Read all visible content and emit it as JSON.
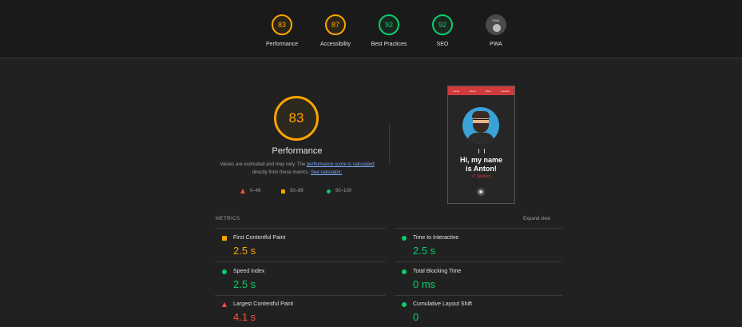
{
  "top_gauges": [
    {
      "score": "83",
      "label": "Performance",
      "color": "#ffa400"
    },
    {
      "score": "87",
      "label": "Accessibility",
      "color": "#ffa400"
    },
    {
      "score": "92",
      "label": "Best Practices",
      "color": "#0cce6b"
    },
    {
      "score": "92",
      "label": "SEO",
      "color": "#0cce6b"
    }
  ],
  "pwa": {
    "badge_text": "PWA",
    "label": "PWA",
    "icon": "pwa-badge-icon"
  },
  "performance": {
    "score": "83",
    "title": "Performance",
    "desc_1": "Values are estimated and may vary. The ",
    "link_1": "performance score is calculated",
    "desc_2": " directly from these metrics. ",
    "link_2": "See calculator."
  },
  "legend": [
    {
      "label": "0–49",
      "icon": "fail-triangle-icon",
      "color": "#ff4e42"
    },
    {
      "label": "50–89",
      "icon": "average-square-icon",
      "color": "#ffa400"
    },
    {
      "label": "90–100",
      "icon": "pass-circle-icon",
      "color": "#0cce6b"
    }
  ],
  "screenshot": {
    "nav": [
      "Home",
      "About",
      "Work",
      "Contact"
    ],
    "heading_1": "Hi, my name",
    "heading_2": "is Anton!",
    "subtitle": "IT Student"
  },
  "metrics": {
    "label": "METRICS",
    "expand": "Expand view",
    "items": [
      {
        "name": "First Contentful Paint",
        "value": "2.5 s",
        "color": "#ffa400"
      },
      {
        "name": "Time to Interactive",
        "value": "2.5 s",
        "color": "#0cce6b"
      },
      {
        "name": "Speed Index",
        "value": "2.5 s",
        "color": "#0cce6b"
      },
      {
        "name": "Total Blocking Time",
        "value": "0 ms",
        "color": "#0cce6b"
      },
      {
        "name": "Largest Contentful Paint",
        "value": "4.1 s",
        "color": "#ff4e42"
      },
      {
        "name": "Cumulative Layout Shift",
        "value": "0",
        "color": "#0cce6b"
      }
    ]
  }
}
